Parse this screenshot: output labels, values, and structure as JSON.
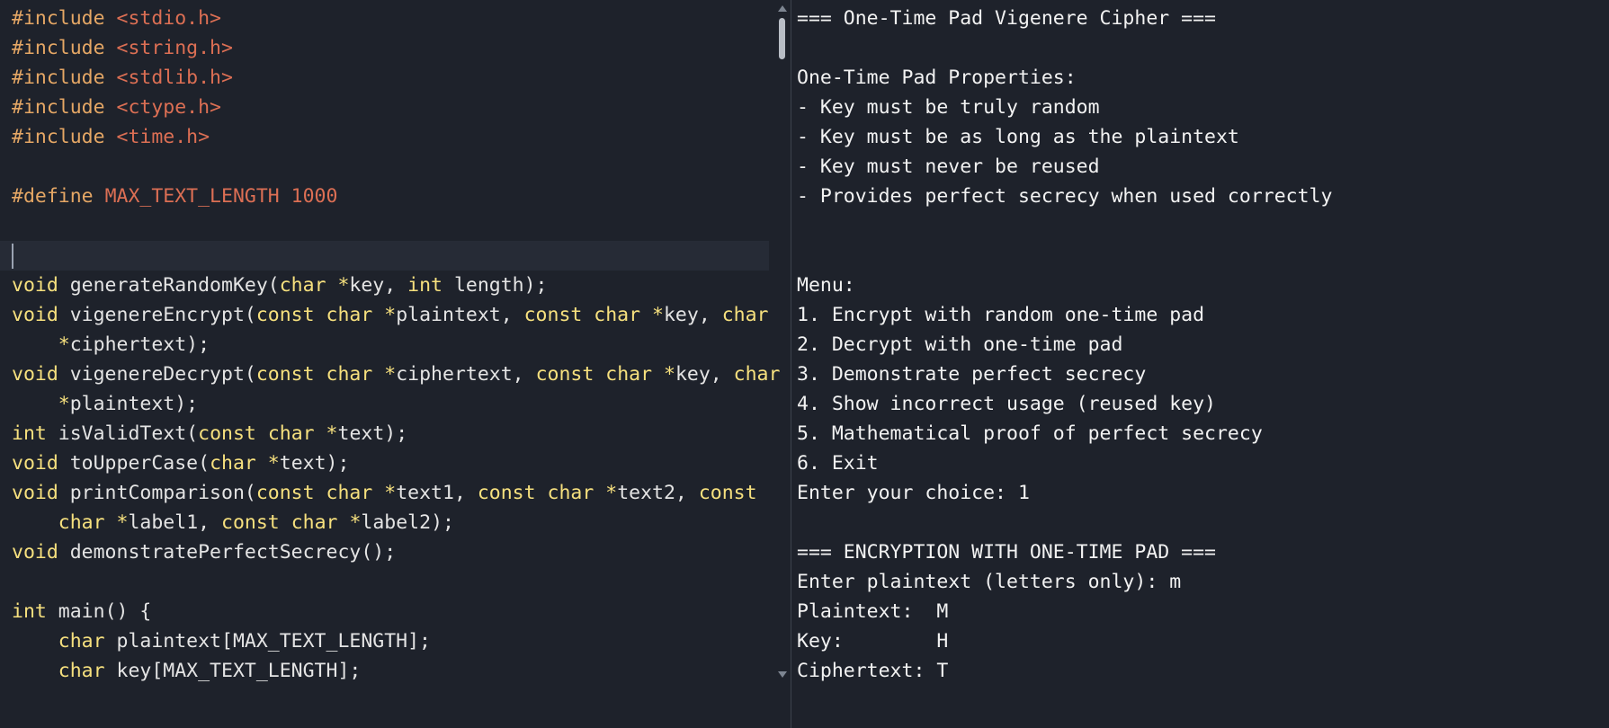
{
  "editor": {
    "lines": [
      [
        {
          "t": "#include ",
          "c": "pp"
        },
        {
          "t": "<stdio.h>",
          "c": "inc"
        }
      ],
      [
        {
          "t": "#include ",
          "c": "pp"
        },
        {
          "t": "<string.h>",
          "c": "inc"
        }
      ],
      [
        {
          "t": "#include ",
          "c": "pp"
        },
        {
          "t": "<stdlib.h>",
          "c": "inc"
        }
      ],
      [
        {
          "t": "#include ",
          "c": "pp"
        },
        {
          "t": "<ctype.h>",
          "c": "inc"
        }
      ],
      [
        {
          "t": "#include ",
          "c": "pp"
        },
        {
          "t": "<time.h>",
          "c": "inc"
        }
      ],
      [],
      [
        {
          "t": "#define ",
          "c": "pp"
        },
        {
          "t": "MAX_TEXT_LENGTH 1000",
          "c": "inc"
        }
      ],
      [],
      [],
      [
        {
          "t": "void",
          "c": "kw"
        },
        {
          "t": " generateRandomKey(",
          "c": "tx"
        },
        {
          "t": "char",
          "c": "kw"
        },
        {
          "t": " ",
          "c": "tx"
        },
        {
          "t": "*",
          "c": "kw"
        },
        {
          "t": "key, ",
          "c": "tx"
        },
        {
          "t": "int",
          "c": "kw"
        },
        {
          "t": " length);",
          "c": "tx"
        }
      ],
      [
        {
          "t": "void",
          "c": "kw"
        },
        {
          "t": " vigenereEncrypt(",
          "c": "tx"
        },
        {
          "t": "const",
          "c": "kw"
        },
        {
          "t": " ",
          "c": "tx"
        },
        {
          "t": "char",
          "c": "kw"
        },
        {
          "t": " ",
          "c": "tx"
        },
        {
          "t": "*",
          "c": "kw"
        },
        {
          "t": "plaintext, ",
          "c": "tx"
        },
        {
          "t": "const",
          "c": "kw"
        },
        {
          "t": " ",
          "c": "tx"
        },
        {
          "t": "char",
          "c": "kw"
        },
        {
          "t": " ",
          "c": "tx"
        },
        {
          "t": "*",
          "c": "kw"
        },
        {
          "t": "key, ",
          "c": "tx"
        },
        {
          "t": "char",
          "c": "kw"
        }
      ],
      [
        {
          "t": "    ",
          "c": "tx"
        },
        {
          "t": "*",
          "c": "kw"
        },
        {
          "t": "ciphertext);",
          "c": "tx"
        }
      ],
      [
        {
          "t": "void",
          "c": "kw"
        },
        {
          "t": " vigenereDecrypt(",
          "c": "tx"
        },
        {
          "t": "const",
          "c": "kw"
        },
        {
          "t": " ",
          "c": "tx"
        },
        {
          "t": "char",
          "c": "kw"
        },
        {
          "t": " ",
          "c": "tx"
        },
        {
          "t": "*",
          "c": "kw"
        },
        {
          "t": "ciphertext, ",
          "c": "tx"
        },
        {
          "t": "const",
          "c": "kw"
        },
        {
          "t": " ",
          "c": "tx"
        },
        {
          "t": "char",
          "c": "kw"
        },
        {
          "t": " ",
          "c": "tx"
        },
        {
          "t": "*",
          "c": "kw"
        },
        {
          "t": "key, ",
          "c": "tx"
        },
        {
          "t": "char",
          "c": "kw"
        }
      ],
      [
        {
          "t": "    ",
          "c": "tx"
        },
        {
          "t": "*",
          "c": "kw"
        },
        {
          "t": "plaintext);",
          "c": "tx"
        }
      ],
      [
        {
          "t": "int",
          "c": "kw"
        },
        {
          "t": " isValidText(",
          "c": "tx"
        },
        {
          "t": "const",
          "c": "kw"
        },
        {
          "t": " ",
          "c": "tx"
        },
        {
          "t": "char",
          "c": "kw"
        },
        {
          "t": " ",
          "c": "tx"
        },
        {
          "t": "*",
          "c": "kw"
        },
        {
          "t": "text);",
          "c": "tx"
        }
      ],
      [
        {
          "t": "void",
          "c": "kw"
        },
        {
          "t": " toUpperCase(",
          "c": "tx"
        },
        {
          "t": "char",
          "c": "kw"
        },
        {
          "t": " ",
          "c": "tx"
        },
        {
          "t": "*",
          "c": "kw"
        },
        {
          "t": "text);",
          "c": "tx"
        }
      ],
      [
        {
          "t": "void",
          "c": "kw"
        },
        {
          "t": " printComparison(",
          "c": "tx"
        },
        {
          "t": "const",
          "c": "kw"
        },
        {
          "t": " ",
          "c": "tx"
        },
        {
          "t": "char",
          "c": "kw"
        },
        {
          "t": " ",
          "c": "tx"
        },
        {
          "t": "*",
          "c": "kw"
        },
        {
          "t": "text1, ",
          "c": "tx"
        },
        {
          "t": "const",
          "c": "kw"
        },
        {
          "t": " ",
          "c": "tx"
        },
        {
          "t": "char",
          "c": "kw"
        },
        {
          "t": " ",
          "c": "tx"
        },
        {
          "t": "*",
          "c": "kw"
        },
        {
          "t": "text2, ",
          "c": "tx"
        },
        {
          "t": "const",
          "c": "kw"
        }
      ],
      [
        {
          "t": "    ",
          "c": "tx"
        },
        {
          "t": "char",
          "c": "kw"
        },
        {
          "t": " ",
          "c": "tx"
        },
        {
          "t": "*",
          "c": "kw"
        },
        {
          "t": "label1, ",
          "c": "tx"
        },
        {
          "t": "const",
          "c": "kw"
        },
        {
          "t": " ",
          "c": "tx"
        },
        {
          "t": "char",
          "c": "kw"
        },
        {
          "t": " ",
          "c": "tx"
        },
        {
          "t": "*",
          "c": "kw"
        },
        {
          "t": "label2);",
          "c": "tx"
        }
      ],
      [
        {
          "t": "void",
          "c": "kw"
        },
        {
          "t": " demonstratePerfectSecrecy();",
          "c": "tx"
        }
      ],
      [],
      [
        {
          "t": "int",
          "c": "kw"
        },
        {
          "t": " main() {",
          "c": "tx"
        }
      ],
      [
        {
          "t": "    ",
          "c": "tx"
        },
        {
          "t": "char",
          "c": "kw"
        },
        {
          "t": " plaintext[MAX_TEXT_LENGTH];",
          "c": "tx"
        }
      ],
      [
        {
          "t": "    ",
          "c": "tx"
        },
        {
          "t": "char",
          "c": "kw"
        },
        {
          "t": " key[MAX_TEXT_LENGTH];",
          "c": "tx"
        }
      ]
    ],
    "cursor_line": 8,
    "colors": {
      "background": "#1e222b",
      "current_line": "#262b36",
      "preprocessor": "#e5a765",
      "include_value": "#dc6f54",
      "keyword": "#f6e07e",
      "text": "#e4e4e4"
    }
  },
  "scrollbar": {
    "up_icon": "triangle-up-icon",
    "down_icon": "triangle-down-icon",
    "position_fraction": 0.0
  },
  "terminal": {
    "lines": [
      "=== One-Time Pad Vigenere Cipher ===",
      "",
      "One-Time Pad Properties:",
      "- Key must be truly random",
      "- Key must be as long as the plaintext",
      "- Key must never be reused",
      "- Provides perfect secrecy when used correctly",
      "",
      "",
      "Menu:",
      "1. Encrypt with random one-time pad",
      "2. Decrypt with one-time pad",
      "3. Demonstrate perfect secrecy",
      "4. Show incorrect usage (reused key)",
      "5. Mathematical proof of perfect secrecy",
      "6. Exit",
      "Enter your choice: 1",
      "",
      "=== ENCRYPTION WITH ONE-TIME PAD ===",
      "Enter plaintext (letters only): m",
      "Plaintext:  M",
      "Key:        H",
      "Ciphertext: T"
    ],
    "colors": {
      "background": "#1e222b",
      "text": "#f2f2f2"
    }
  }
}
